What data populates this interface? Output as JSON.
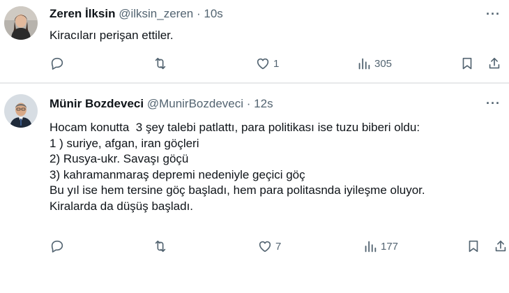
{
  "tweets": [
    {
      "name": "Zeren İlksin",
      "handle": "@ilksin_zeren",
      "separator": "·",
      "time": "10s",
      "text": "Kiracıları perişan ettiler.",
      "likes": "1",
      "views": "305"
    },
    {
      "name": "Münir Bozdeveci",
      "handle": "@MunirBozdeveci",
      "separator": "·",
      "time": "12s",
      "text": "Hocam konutta  3 şey talebi patlattı, para politikası ise tuzu biberi oldu:\n1 ) suriye, afgan, iran göçleri\n2) Rusya-ukr. Savaşı göçü\n3) kahramanmaraş depremi nedeniyle geçici göç\nBu yıl ise hem tersine göç başladı, hem para politasnda iyileşme oluyor.\nKiralarda da düşüş başladı.",
      "likes": "7",
      "views": "177"
    }
  ],
  "icons": [
    "reply-icon",
    "retweet-icon",
    "like-icon",
    "views-icon",
    "bookmark-icon",
    "share-icon",
    "more-icon"
  ],
  "colors": {
    "text": "#0f1419",
    "secondary": "#536471",
    "divider": "#e7e9ea",
    "background": "#ffffff"
  }
}
